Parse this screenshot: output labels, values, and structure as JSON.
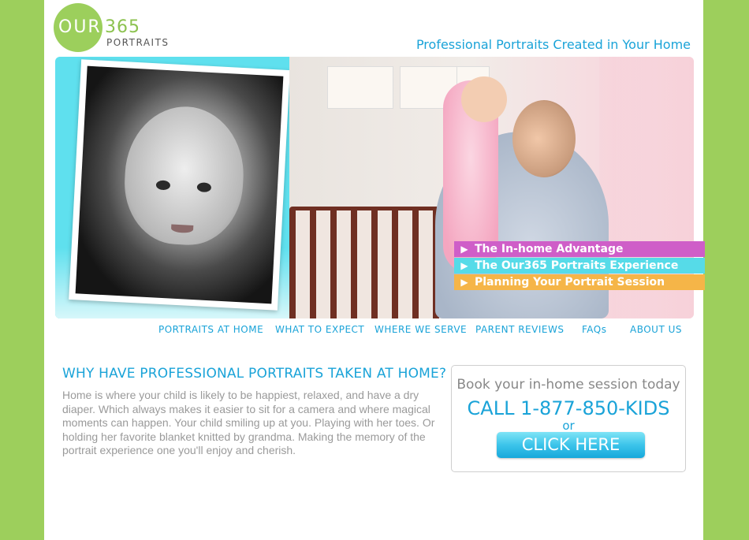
{
  "logo": {
    "our": "OUR",
    "number": "365",
    "portraits": "PORTRAITS"
  },
  "tagline": "Professional Portraits Created in Your Home",
  "promos": [
    {
      "label": "The In-home Advantage",
      "color": "#cf5ec8"
    },
    {
      "label": "The Our365 Portraits Experience",
      "color": "#56dbe8"
    },
    {
      "label": "Planning Your Portrait Session",
      "color": "#f5b548"
    }
  ],
  "nav": [
    "PORTRAITS AT HOME",
    "WHAT TO EXPECT",
    "WHERE WE SERVE",
    "PARENT REVIEWS",
    "FAQs",
    "ABOUT US"
  ],
  "content": {
    "heading": "WHY HAVE PROFESSIONAL PORTRAITS TAKEN AT HOME?",
    "body": "Home is where your child is likely to be happiest, relaxed, and have a dry diaper. Which always makes it easier to sit for a camera and where magical moments can happen. Your child smiling up at you. Playing with her toes. Or holding her favorite blanket knitted by grandma. Making the memory of the portrait experience one you'll enjoy and cherish."
  },
  "booking": {
    "title": "Book your in-home session today",
    "phone": "CALL 1-877-850-KIDS",
    "or": "or",
    "button": "CLICK HERE"
  },
  "colors": {
    "background": "#9dcf5c",
    "accent": "#1aa3d8",
    "logo_green": "#9ccf5c"
  }
}
